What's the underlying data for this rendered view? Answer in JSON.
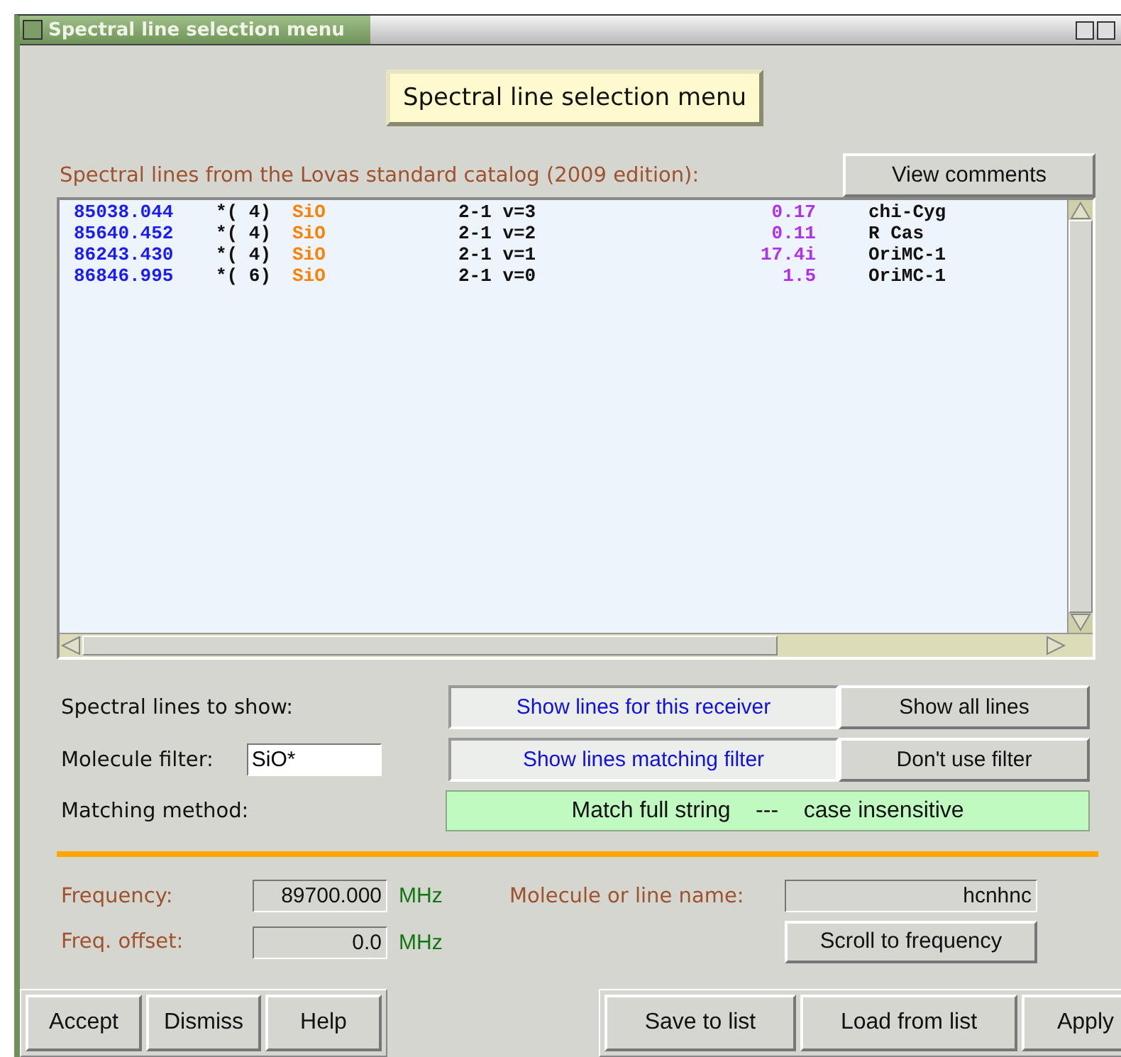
{
  "window": {
    "title": "Spectral line selection menu"
  },
  "heading": "Spectral line selection menu",
  "catalog_label": "Spectral lines from the Lovas standard catalog (2009 edition):",
  "view_comments_button": "View comments",
  "lines": [
    {
      "frequency": "85038.044",
      "count": "*( 4)",
      "molecule": "SiO",
      "transition": "2-1 v=3",
      "intensity": "0.17",
      "source": "chi-Cyg"
    },
    {
      "frequency": "85640.452",
      "count": "*( 4)",
      "molecule": "SiO",
      "transition": "2-1 v=2",
      "intensity": "0.11",
      "source": "R Cas"
    },
    {
      "frequency": "86243.430",
      "count": "*( 4)",
      "molecule": "SiO",
      "transition": "2-1 v=1",
      "intensity": "17.4i",
      "source": "OriMC-1"
    },
    {
      "frequency": "86846.995",
      "count": "*( 6)",
      "molecule": "SiO",
      "transition": "2-1 v=0",
      "intensity": "1.5",
      "source": "OriMC-1"
    }
  ],
  "lines_to_show": {
    "label": "Spectral lines to show:",
    "options": [
      {
        "label": "Show lines for this receiver",
        "selected": true
      },
      {
        "label": "Show all lines",
        "selected": false
      }
    ]
  },
  "molecule_filter": {
    "label": "Molecule filter:",
    "value": "SiO*",
    "options": [
      {
        "label": "Show lines matching filter",
        "selected": true
      },
      {
        "label": "Don't use filter",
        "selected": false
      }
    ]
  },
  "matching_method": {
    "label": "Matching method:",
    "value": "Match full string    ---    case insensitive"
  },
  "frequency": {
    "label": "Frequency:",
    "value": "89700.000",
    "unit": "MHz"
  },
  "freq_offset": {
    "label": "Freq. offset:",
    "value": "0.0",
    "unit": "MHz"
  },
  "molecule_name": {
    "label": "Molecule or line name:",
    "value": "hcnhnc"
  },
  "scroll_button": "Scroll to frequency",
  "left_buttons": [
    "Accept",
    "Dismiss",
    "Help"
  ],
  "right_buttons": [
    "Save to list",
    "Load from list",
    "Apply"
  ]
}
